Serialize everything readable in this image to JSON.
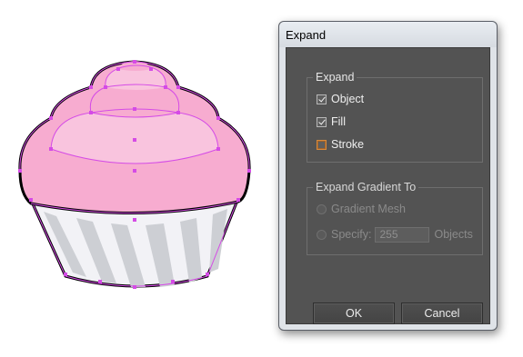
{
  "dialog": {
    "title": "Expand",
    "expand_group": {
      "title": "Expand",
      "options": [
        {
          "label": "Object",
          "checked": true
        },
        {
          "label": "Fill",
          "checked": true
        },
        {
          "label": "Stroke",
          "checked": false
        }
      ]
    },
    "gradient_group": {
      "title": "Expand Gradient To",
      "gradient_mesh_label": "Gradient Mesh",
      "specify_label": "Specify:",
      "specify_value": "255",
      "objects_label": "Objects"
    },
    "ok_label": "OK",
    "cancel_label": "Cancel"
  },
  "colors": {
    "frosting": "#f7acd0",
    "frosting_light": "#f9c4de",
    "wrapper_light": "#f2f2f6",
    "wrapper_dark": "#cdcfd4",
    "anchor": "#d54be6"
  }
}
